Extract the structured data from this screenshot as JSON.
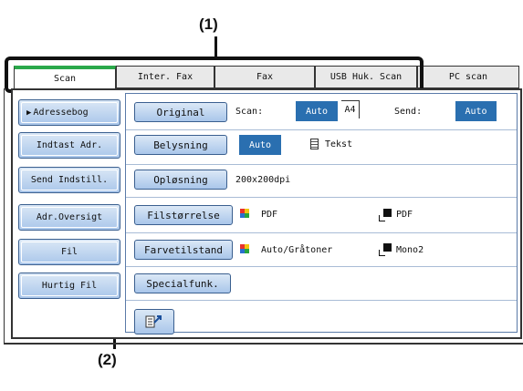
{
  "callouts": {
    "one": "(1)",
    "two": "(2)"
  },
  "tabs": [
    "Scan",
    "Inter. Fax",
    "Fax",
    "USB Huk. Scan",
    "PC scan"
  ],
  "sidebar": [
    "Adressebog",
    "Indtast Adr.",
    "Send Indstill.",
    "Adr.Oversigt",
    "Fil",
    "Hurtig Fil"
  ],
  "original": {
    "button": "Original",
    "scan_label": "Scan:",
    "scan_value": "Auto",
    "size": "A4",
    "send_label": "Send:",
    "send_value": "Auto"
  },
  "belysning": {
    "button": "Belysning",
    "value": "Auto",
    "mode": "Tekst"
  },
  "oplosning": {
    "button": "Opløsning",
    "value": "200x200dpi"
  },
  "filstorrelse": {
    "button": "Filstørrelse",
    "color_format": "PDF",
    "mono_format": "PDF"
  },
  "farvetilstand": {
    "button": "Farvetilstand",
    "color_mode": "Auto/Gråtoner",
    "mono_mode": "Mono2"
  },
  "special": {
    "button": "Specialfunk."
  },
  "colors": {
    "active_tab": "#2aa84a",
    "value_blue": "#2a6fb0",
    "button_blue": "#a9c6ea"
  }
}
